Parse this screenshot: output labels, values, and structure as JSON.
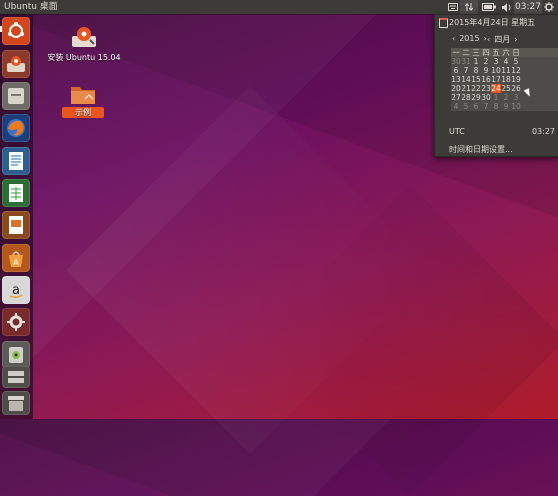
{
  "top_panel": {
    "title": "Ubuntu 桌面",
    "clock": "03:27",
    "indicators": [
      "keyboard-icon",
      "network-icon",
      "battery-icon",
      "volume-icon",
      "gear-icon"
    ]
  },
  "launcher": {
    "items": [
      {
        "name": "dash-home",
        "icon": "ubuntu-logo-icon",
        "color": "#e95420"
      },
      {
        "name": "installer",
        "icon": "installer-icon",
        "color": "#c0622e"
      },
      {
        "name": "files",
        "icon": "file-manager-icon",
        "color": "#8e8a82"
      },
      {
        "name": "firefox",
        "icon": "firefox-icon",
        "color": "#e66000"
      },
      {
        "name": "writer",
        "icon": "writer-icon",
        "color": "#1e6fb8"
      },
      {
        "name": "calc",
        "icon": "calc-icon",
        "color": "#2e9d3a"
      },
      {
        "name": "impress",
        "icon": "impress-icon",
        "color": "#d9722b"
      },
      {
        "name": "software-center",
        "icon": "software-center-icon",
        "color": "#e07a1f"
      },
      {
        "name": "amazon",
        "icon": "amazon-icon",
        "color": "#f0f0f0"
      },
      {
        "name": "system-settings",
        "icon": "system-settings-icon",
        "color": "#b72f2f"
      },
      {
        "name": "cd-drive",
        "icon": "cd-drive-icon",
        "color": "#8d8c88"
      },
      {
        "name": "workspaces",
        "icon": "workspaces-icon",
        "color": "#6a6965"
      },
      {
        "name": "trash",
        "icon": "trash-icon",
        "color": "#9c9b96"
      }
    ]
  },
  "desktop": {
    "icons": [
      {
        "label": "安装 Ubuntu 15.04"
      },
      {
        "label": "示例"
      }
    ]
  },
  "calendar": {
    "date_line": "2015年4月24日 星期五",
    "year": "2015",
    "month": "四月",
    "weekday_headers": [
      "一",
      "二",
      "三",
      "四",
      "五",
      "六",
      "日"
    ],
    "weeks": [
      [
        "30",
        "31",
        "1",
        "2",
        "3",
        "4",
        "5"
      ],
      [
        "6",
        "7",
        "8",
        "9",
        "10",
        "11",
        "12"
      ],
      [
        "13",
        "14",
        "15",
        "16",
        "17",
        "18",
        "19"
      ],
      [
        "20",
        "21",
        "22",
        "23",
        "24",
        "25",
        "26"
      ],
      [
        "27",
        "28",
        "29",
        "30",
        "1",
        "2",
        "3"
      ],
      [
        "4",
        "5",
        "6",
        "7",
        "8",
        "9",
        "10"
      ]
    ],
    "today": "24",
    "timezone": "UTC",
    "timezone_time": "03:27",
    "settings_link": "时间和日期设置..."
  }
}
